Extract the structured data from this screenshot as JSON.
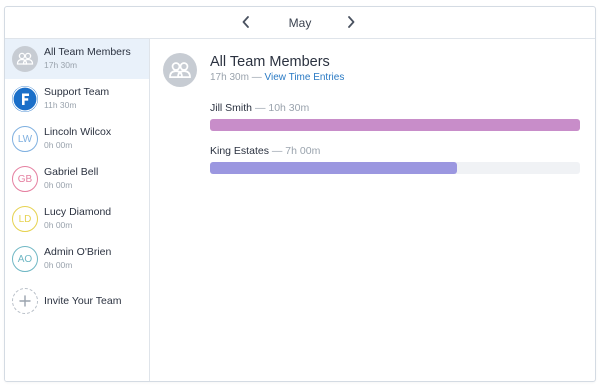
{
  "header": {
    "month": "May",
    "prev_icon": "chevron-left-icon",
    "next_icon": "chevron-right-icon"
  },
  "sidebar": {
    "items": [
      {
        "name": "All Team Members",
        "time": "17h 30m",
        "avatar_type": "group-icon",
        "selected": true
      },
      {
        "name": "Support Team",
        "time": "11h 30m",
        "avatar_type": "logo",
        "initials": "F",
        "color": "#1a6fc9"
      },
      {
        "name": "Lincoln Wilcox",
        "time": "0h 00m",
        "initials": "LW",
        "color": "#7fb0e0"
      },
      {
        "name": "Gabriel Bell",
        "time": "0h 00m",
        "initials": "GB",
        "color": "#e57fa0"
      },
      {
        "name": "Lucy Diamond",
        "time": "0h 00m",
        "initials": "LD",
        "color": "#e6d24f"
      },
      {
        "name": "Admin O'Brien",
        "time": "0h 00m",
        "initials": "AO",
        "color": "#6fb7c4"
      }
    ],
    "invite_label": "Invite Your Team",
    "invite_icon": "plus-icon"
  },
  "main": {
    "title": "All Team Members",
    "total_time": "17h 30m",
    "separator": "—",
    "link_label": "View Time Entries",
    "entries": [
      {
        "name": "Jill Smith",
        "time": "10h 30m",
        "fraction": 1.0,
        "color": "#c88dc9"
      },
      {
        "name": "King Estates",
        "time": "7h 00m",
        "fraction": 0.667,
        "color": "#9b97e0"
      }
    ]
  }
}
